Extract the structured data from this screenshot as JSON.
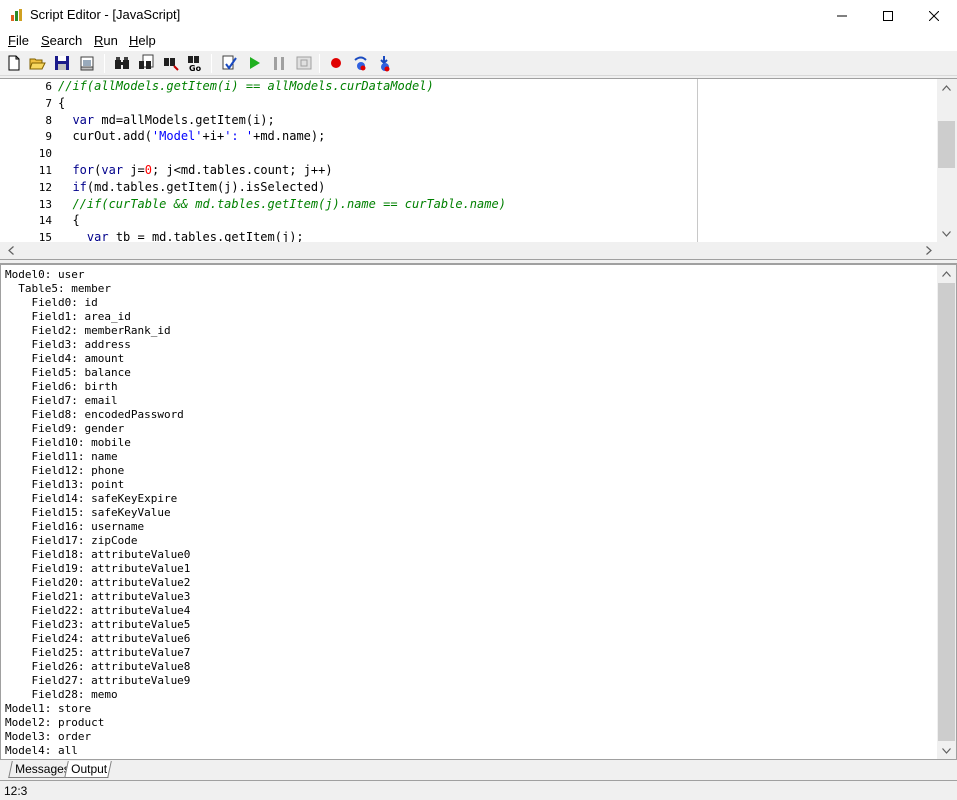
{
  "window": {
    "title": "Script Editor - [JavaScript]"
  },
  "menu": {
    "items": [
      "File",
      "Search",
      "Run",
      "Help"
    ]
  },
  "toolbar": {
    "buttons": [
      "new-file-icon",
      "open-folder-icon",
      "save-icon",
      "print-preview-icon",
      "find-icon",
      "find-next-icon",
      "replace-icon",
      "goto-icon",
      "check-syntax-icon",
      "run-icon",
      "pause-icon",
      "stop-icon",
      "breakpoint-icon",
      "step-into-icon",
      "step-over-icon"
    ]
  },
  "editor": {
    "lines": [
      {
        "num": "6",
        "parts": [
          {
            "t": "//if(allModels.getItem(i) == allModels.curDataModel)",
            "c": "com"
          }
        ]
      },
      {
        "num": "7",
        "parts": [
          {
            "t": "{",
            "c": "txt"
          }
        ]
      },
      {
        "num": "8",
        "parts": [
          {
            "t": "  ",
            "c": "txt"
          },
          {
            "t": "var",
            "c": "kw"
          },
          {
            "t": " md=allModels.getItem(i);",
            "c": "txt"
          }
        ]
      },
      {
        "num": "9",
        "parts": [
          {
            "t": "  curOut.add(",
            "c": "txt"
          },
          {
            "t": "'Model'",
            "c": "str"
          },
          {
            "t": "+i+",
            "c": "txt"
          },
          {
            "t": "': '",
            "c": "str"
          },
          {
            "t": "+md.name);",
            "c": "txt"
          }
        ]
      },
      {
        "num": "10",
        "parts": []
      },
      {
        "num": "11",
        "parts": [
          {
            "t": "  ",
            "c": "txt"
          },
          {
            "t": "for",
            "c": "kw"
          },
          {
            "t": "(",
            "c": "txt"
          },
          {
            "t": "var",
            "c": "kw"
          },
          {
            "t": " j=",
            "c": "txt"
          },
          {
            "t": "0",
            "c": "num"
          },
          {
            "t": "; j<md.tables.count; j++)",
            "c": "txt"
          }
        ]
      },
      {
        "num": "12",
        "parts": [
          {
            "t": "  ",
            "c": "txt"
          },
          {
            "t": "if",
            "c": "kw"
          },
          {
            "t": "(md.tables.getItem(j).isSelected)",
            "c": "txt"
          }
        ]
      },
      {
        "num": "13",
        "parts": [
          {
            "t": "  //if(curTable && md.tables.getItem(j).name == curTable.name)",
            "c": "com"
          }
        ]
      },
      {
        "num": "14",
        "parts": [
          {
            "t": "  {",
            "c": "txt"
          }
        ]
      },
      {
        "num": "15",
        "parts": [
          {
            "t": "    ",
            "c": "txt"
          },
          {
            "t": "var",
            "c": "kw"
          },
          {
            "t": " tb = md.tables.getItem(j);",
            "c": "txt"
          }
        ]
      }
    ]
  },
  "output": {
    "lines": [
      "Model0: user",
      "  Table5: member",
      "    Field0: id",
      "    Field1: area_id",
      "    Field2: memberRank_id",
      "    Field3: address",
      "    Field4: amount",
      "    Field5: balance",
      "    Field6: birth",
      "    Field7: email",
      "    Field8: encodedPassword",
      "    Field9: gender",
      "    Field10: mobile",
      "    Field11: name",
      "    Field12: phone",
      "    Field13: point",
      "    Field14: safeKeyExpire",
      "    Field15: safeKeyValue",
      "    Field16: username",
      "    Field17: zipCode",
      "    Field18: attributeValue0",
      "    Field19: attributeValue1",
      "    Field20: attributeValue2",
      "    Field21: attributeValue3",
      "    Field22: attributeValue4",
      "    Field23: attributeValue5",
      "    Field24: attributeValue6",
      "    Field25: attributeValue7",
      "    Field26: attributeValue8",
      "    Field27: attributeValue9",
      "    Field28: memo",
      "Model1: store",
      "Model2: product",
      "Model3: order",
      "Model4: all"
    ]
  },
  "tabs": {
    "messages": "Messages",
    "output": "Output"
  },
  "status": {
    "cursor": "12:3"
  }
}
